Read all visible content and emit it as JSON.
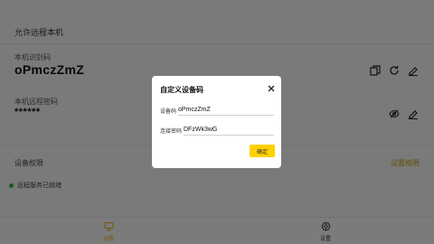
{
  "page": {
    "title": "允许远程本机",
    "device_id_label": "本机识别码",
    "device_id_value": "oPmczZmZ",
    "password_label": "本机远程密码",
    "password_value": "******",
    "section_label": "设备权限",
    "section_link": "设置权限",
    "status_text": "远程服务已就绪"
  },
  "bottom_nav": {
    "items": [
      {
        "label": "远程",
        "icon": "remote-icon",
        "active": true
      },
      {
        "label": "设置",
        "icon": "gear-icon",
        "active": false
      }
    ]
  },
  "dialog": {
    "title": "自定义设备码",
    "id_label": "设备码",
    "id_value": "oPmczZmZ",
    "password_label": "连接密码",
    "password_value": "DFzWk3wG",
    "confirm_label": "确定"
  },
  "colors": {
    "accent": "#ffd100",
    "accent_text": "#e0b000",
    "link": "#c79a00",
    "status_ok": "#2fb344",
    "overlay": "rgba(0,0,0,0.5)"
  }
}
